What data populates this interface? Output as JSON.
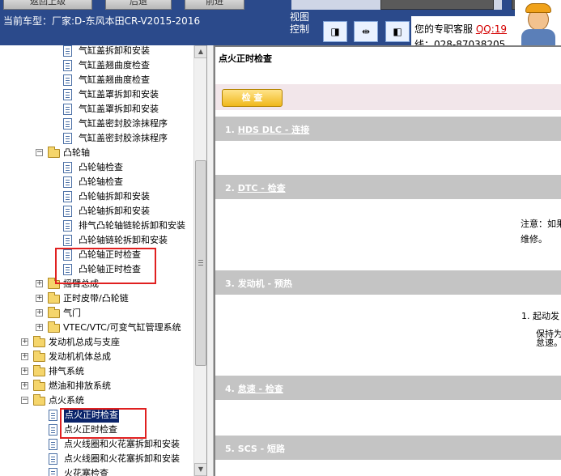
{
  "toolbar": {
    "buttons": [
      "返回上级",
      "后退",
      "前进"
    ],
    "car_label": "当前车型：厂家:D-东风本田CR-V2015-2016",
    "view_control": "视图控制",
    "nav_buttons": [
      "◨",
      "⇹",
      "◧"
    ],
    "service_text": "您的专职客服",
    "service_qq": "QQ:19",
    "service_phone": "线：028-87038205"
  },
  "tree": {
    "items": [
      {
        "label": "气缸盖拆卸和安装",
        "type": "doc"
      },
      {
        "label": "气缸盖翘曲度检查",
        "type": "doc"
      },
      {
        "label": "气缸盖翘曲度检查",
        "type": "doc"
      },
      {
        "label": "气缸盖罩拆卸和安装",
        "type": "doc"
      },
      {
        "label": "气缸盖罩拆卸和安装",
        "type": "doc"
      },
      {
        "label": "气缸盖密封胶涂抹程序",
        "type": "doc"
      },
      {
        "label": "气缸盖密封胶涂抹程序",
        "type": "doc"
      },
      {
        "label": "凸轮轴",
        "type": "folder",
        "expander": "−"
      },
      {
        "label": "凸轮轴检查",
        "type": "doc"
      },
      {
        "label": "凸轮轴检查",
        "type": "doc"
      },
      {
        "label": "凸轮轴拆卸和安装",
        "type": "doc"
      },
      {
        "label": "凸轮轴拆卸和安装",
        "type": "doc"
      },
      {
        "label": "排气凸轮轴链轮拆卸和安装",
        "type": "doc"
      },
      {
        "label": "凸轮轴链轮拆卸和安装",
        "type": "doc"
      },
      {
        "label": "凸轮轴正时检查",
        "type": "doc"
      },
      {
        "label": "凸轮轴正时检查",
        "type": "doc"
      },
      {
        "label": "摇臂总成",
        "type": "folder",
        "expander": "+"
      },
      {
        "label": "正时皮带/凸轮链",
        "type": "folder",
        "expander": "+"
      },
      {
        "label": "气门",
        "type": "folder",
        "expander": "+"
      },
      {
        "label": "VTEC/VTC/可变气缸管理系统",
        "type": "folder",
        "expander": "+"
      },
      {
        "label": "发动机总成与支座",
        "type": "folder",
        "expander": "+"
      },
      {
        "label": "发动机机体总成",
        "type": "folder",
        "expander": "+"
      },
      {
        "label": "排气系统",
        "type": "folder",
        "expander": "+"
      },
      {
        "label": "燃油和排放系统",
        "type": "folder",
        "expander": "+"
      },
      {
        "label": "点火系统",
        "type": "folder",
        "expander": "−"
      },
      {
        "label": "点火正时检查",
        "type": "doc",
        "selected": true
      },
      {
        "label": "点火正时检查",
        "type": "doc"
      },
      {
        "label": "点火线圈和火花塞拆卸和安装",
        "type": "doc"
      },
      {
        "label": "点火线圈和火花塞拆卸和安装",
        "type": "doc"
      },
      {
        "label": "火花塞检查",
        "type": "doc"
      }
    ]
  },
  "content": {
    "title": "点火正时检查",
    "check_button": "检 查",
    "steps": [
      {
        "num": "1.",
        "link": "HDS DLC - 连接",
        "suffix": ""
      },
      {
        "num": "2.",
        "link": "DTC - 检查",
        "suffix": ""
      },
      {
        "num": "3.",
        "link": "",
        "suffix": "发动机 - 预热"
      },
      {
        "num": "4.",
        "link": "怠速 - 检查",
        "suffix": ""
      },
      {
        "num": "5.",
        "link": "",
        "suffix": "SCS - 短路"
      }
    ],
    "note_line1": "注意：如果",
    "note_line2": "维修。",
    "step3_item": "1.  起动发",
    "step3_line2": "保持为",
    "step3_line3": "怠速。"
  },
  "colors": {
    "toolbar_bg": "#2b4a8b",
    "step_band": "#c4c4c4",
    "highlight_box": "#e02020",
    "selection": "#0a246a",
    "check_button": "#f0b81c"
  }
}
